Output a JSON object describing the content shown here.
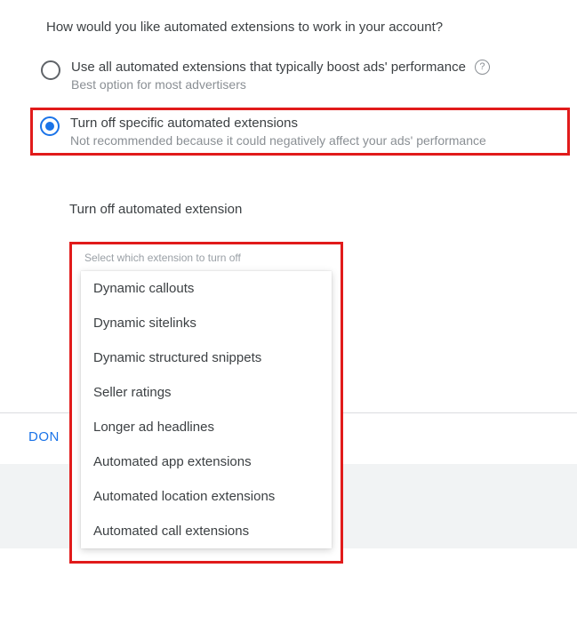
{
  "question": "How would you like automated extensions to work in your account?",
  "option1": {
    "label": "Use all automated extensions that typically boost ads' performance",
    "sub": "Best option for most advertisers"
  },
  "option2": {
    "label": "Turn off specific automated extensions",
    "sub": "Not recommended because it could negatively affect your ads' performance"
  },
  "section_title": "Turn off automated extension",
  "select_label": "Select which extension to turn off",
  "dropdown": {
    "items": [
      "Dynamic callouts",
      "Dynamic sitelinks",
      "Dynamic structured snippets",
      "Seller ratings",
      "Longer ad headlines",
      "Automated app extensions",
      "Automated location extensions",
      "Automated call extensions"
    ]
  },
  "done": "DON"
}
